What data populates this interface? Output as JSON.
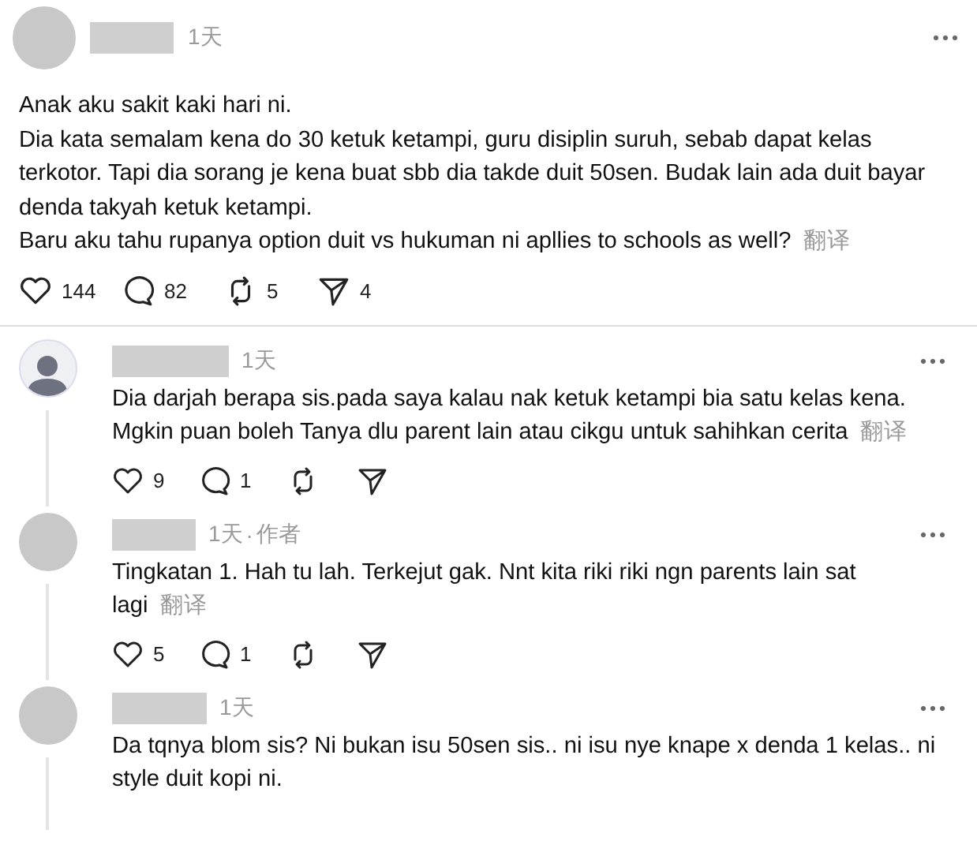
{
  "post": {
    "avatar": {
      "kind": "plain"
    },
    "time": "1天",
    "paragraphs": [
      "Anak aku sakit kaki hari ni.",
      "Dia kata semalam kena do 30 ketuk ketampi, guru disiplin suruh, sebab dapat kelas terkotor. Tapi dia sorang je kena buat sbb dia takde duit 50sen. Budak lain ada duit bayar denda takyah ketuk ketampi.",
      "Baru aku tahu rupanya option duit vs hukuman ni apllies to schools as well?"
    ],
    "translate": "翻译",
    "stats": [
      {
        "kind": "like",
        "count": "144"
      },
      {
        "kind": "comment",
        "count": "82"
      },
      {
        "kind": "repost",
        "count": "5"
      },
      {
        "kind": "share",
        "count": "4"
      }
    ]
  },
  "replies": [
    {
      "avatar": {
        "kind": "silhouette"
      },
      "time": "1天",
      "paragraphs": [
        "Dia darjah berapa sis.pada saya kalau nak ketuk ketampi bia satu kelas kena. Mgkin puan boleh Tanya dlu parent lain atau cikgu untuk sahihkan cerita"
      ],
      "translate": "翻译",
      "thread_line": true,
      "stats": [
        {
          "kind": "like",
          "count": "9"
        },
        {
          "kind": "comment",
          "count": "1"
        },
        {
          "kind": "repost"
        },
        {
          "kind": "share"
        }
      ]
    },
    {
      "avatar": {
        "kind": "plain"
      },
      "time": "1天",
      "separator": "·",
      "badge": "作者",
      "paragraphs": [
        "Tingkatan 1. Hah tu lah. Terkejut gak. Nnt kita riki riki ngn parents lain sat lagi"
      ],
      "translate": "翻译",
      "thread_line": true,
      "stats": [
        {
          "kind": "like",
          "count": "5"
        },
        {
          "kind": "comment",
          "count": "1"
        },
        {
          "kind": "repost"
        },
        {
          "kind": "share"
        }
      ]
    },
    {
      "avatar": {
        "kind": "plain"
      },
      "time": "1天",
      "paragraphs": [
        "Da tqnya blom sis? Ni bukan isu 50sen sis.. ni isu nye knape x denda 1 kelas.. ni style duit kopi ni."
      ],
      "thread_line": true
    }
  ]
}
